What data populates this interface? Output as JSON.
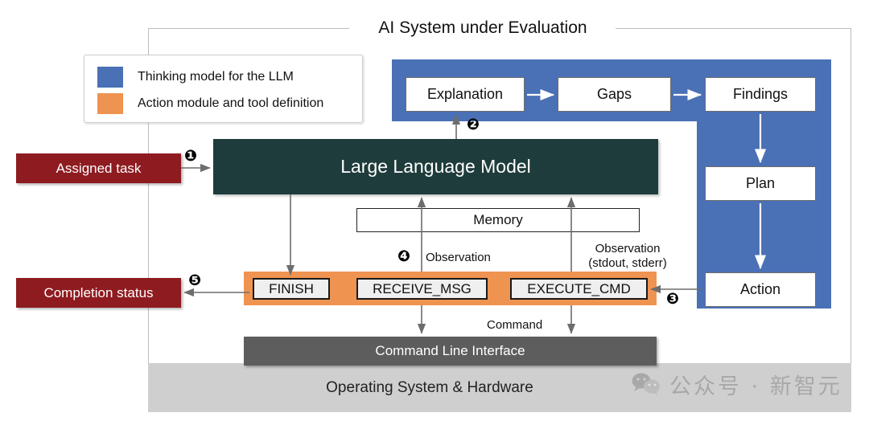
{
  "title": "AI System under Evaluation",
  "legend": {
    "items": [
      {
        "label": "Thinking model for the LLM",
        "color": "#4a70b5"
      },
      {
        "label": "Action module and tool definition",
        "color": "#ef9350"
      }
    ]
  },
  "thinking_panel": {
    "color": "#4a70b5",
    "nodes": [
      {
        "id": "explanation",
        "label": "Explanation"
      },
      {
        "id": "gaps",
        "label": "Gaps"
      },
      {
        "id": "findings",
        "label": "Findings"
      },
      {
        "id": "plan",
        "label": "Plan"
      },
      {
        "id": "action",
        "label": "Action"
      }
    ]
  },
  "llm": {
    "label": "Large Language Model",
    "color": "#1e3c3b"
  },
  "memory": {
    "label": "Memory"
  },
  "action_module": {
    "color": "#ef9350",
    "tools": [
      {
        "id": "finish",
        "label": "FINISH"
      },
      {
        "id": "receive_msg",
        "label": "RECEIVE_MSG"
      },
      {
        "id": "execute_cmd",
        "label": "EXECUTE_CMD"
      }
    ]
  },
  "io_boxes": {
    "assigned_task": "Assigned task",
    "completion_status": "Completion status",
    "color": "#8e1b20"
  },
  "system": {
    "cli": "Command Line Interface",
    "os": "Operating System & Hardware"
  },
  "edge_labels": {
    "observation": "Observation",
    "observation_std_line1": "Observation",
    "observation_std_line2": "(stdout, stderr)",
    "command": "Command"
  },
  "steps": {
    "one": "❶",
    "two": "❷",
    "three": "❸",
    "four": "❹",
    "five": "❺"
  },
  "watermark": {
    "text": "公众号 · 新智元"
  }
}
